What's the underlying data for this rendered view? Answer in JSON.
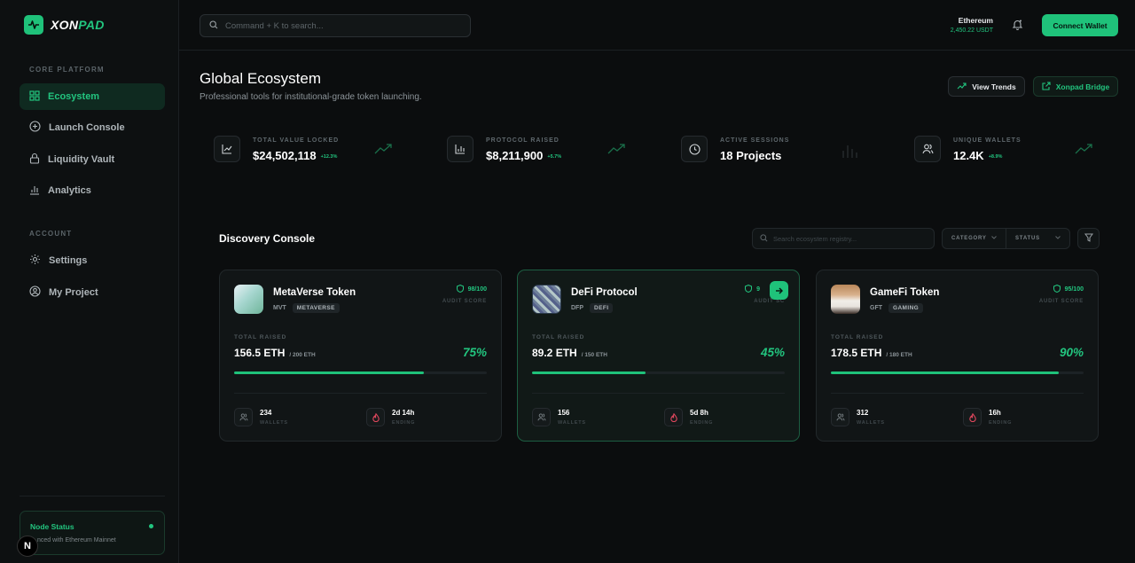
{
  "brand": {
    "name_a": "XON",
    "name_b": "PAD"
  },
  "sidebar": {
    "section_platform": "CORE PLATFORM",
    "section_account": "ACCOUNT",
    "items": [
      {
        "label": "Ecosystem",
        "icon": "grid-icon"
      },
      {
        "label": "Launch Console",
        "icon": "plus-circle-icon"
      },
      {
        "label": "Liquidity Vault",
        "icon": "lock-icon"
      },
      {
        "label": "Analytics",
        "icon": "bar-chart-icon"
      },
      {
        "label": "Settings",
        "icon": "gear-icon"
      },
      {
        "label": "My Project",
        "icon": "user-circle-icon"
      }
    ],
    "node": {
      "title": "Node Status",
      "sub": "nced with Ethereum Mainnet"
    },
    "badge": "N"
  },
  "topbar": {
    "search_placeholder": "Command + K to search...",
    "network": "Ethereum",
    "balance": "2,450.22 USDT",
    "connect": "Connect Wallet"
  },
  "header": {
    "title": "Global Ecosystem",
    "subtitle": "Professional tools for institutional-grade token launching.",
    "trends": "View Trends",
    "bridge": "Xonpad Bridge"
  },
  "stats": [
    {
      "label": "TOTAL VALUE LOCKED",
      "value": "$24,502,118",
      "delta": "+12.3%"
    },
    {
      "label": "PROTOCOL RAISED",
      "value": "$8,211,900",
      "delta": "+5.7%"
    },
    {
      "label": "ACTIVE SESSIONS",
      "value": "18 Projects",
      "delta": ""
    },
    {
      "label": "UNIQUE WALLETS",
      "value": "12.4K",
      "delta": "+8.9%"
    }
  ],
  "discovery": {
    "title": "Discovery Console",
    "search_placeholder": "Search ecosystem registry...",
    "filter_category": "CATEGORY",
    "filter_status": "STATUS"
  },
  "cards": [
    {
      "name": "MetaVerse Token",
      "symbol": "MVT",
      "tag": "METAVERSE",
      "audit": "98/100",
      "audit_label": "AUDIT SCORE",
      "raised_label": "TOTAL RAISED",
      "raised": "156.5 ETH",
      "goal": "/ 200 ETH",
      "pct": "75%",
      "progress": 0.75,
      "wallets": "234",
      "wallets_label": "WALLETS",
      "ending": "2d 14h",
      "ending_label": "ENDING"
    },
    {
      "name": "DeFi Protocol",
      "symbol": "DFP",
      "tag": "DEFI",
      "audit": "9",
      "audit_label": "AUDIT SC",
      "raised_label": "TOTAL RAISED",
      "raised": "89.2 ETH",
      "goal": "/ 150 ETH",
      "pct": "45%",
      "progress": 0.45,
      "wallets": "156",
      "wallets_label": "WALLETS",
      "ending": "5d 8h",
      "ending_label": "ENDING"
    },
    {
      "name": "GameFi Token",
      "symbol": "GFT",
      "tag": "GAMING",
      "audit": "95/100",
      "audit_label": "AUDIT SCORE",
      "raised_label": "TOTAL RAISED",
      "raised": "178.5 ETH",
      "goal": "/ 180 ETH",
      "pct": "90%",
      "progress": 0.9,
      "wallets": "312",
      "wallets_label": "WALLETS",
      "ending": "16h",
      "ending_label": "ENDING"
    }
  ],
  "colors": {
    "accent": "#1fc27a",
    "bg": "#0b0d0e",
    "ending_icon": "#e0475d"
  }
}
